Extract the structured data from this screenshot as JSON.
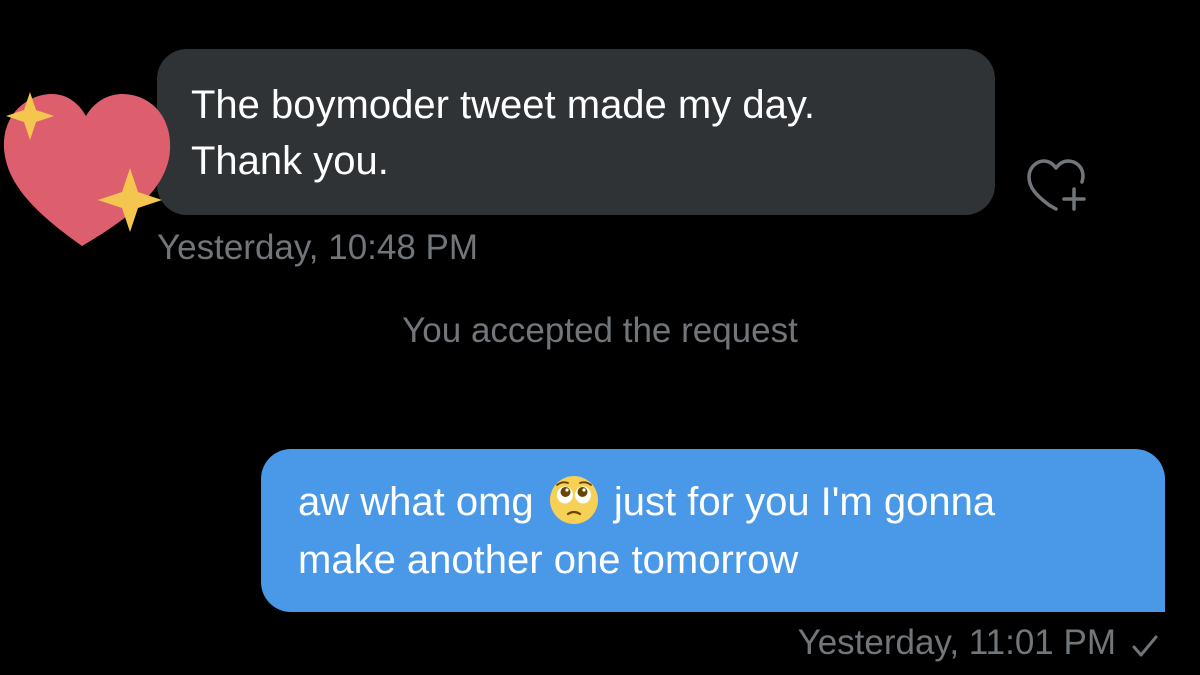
{
  "conversation": {
    "received_message": {
      "line1": "The boymoder tweet made my day.",
      "line2": "Thank you.",
      "reaction": "sparkling-heart",
      "timestamp": "Yesterday, 10:48 PM",
      "bubble_color": "#2f3336"
    },
    "system_note": "You accepted the request",
    "sent_message": {
      "line1_before": "aw what omg",
      "emoji": "pleading-face",
      "line1_after": "just for you I'm gonna",
      "line2": "make another one tomorrow",
      "timestamp": "Yesterday, 11:01 PM",
      "status_icon": "check-icon",
      "bubble_color": "#4a99e9"
    },
    "react_button_icon": "heart-plus-icon",
    "colors": {
      "background": "#000000",
      "muted_text": "#71767b",
      "heart": "#dd5e6c",
      "sparkle": "#f4c54f"
    }
  }
}
